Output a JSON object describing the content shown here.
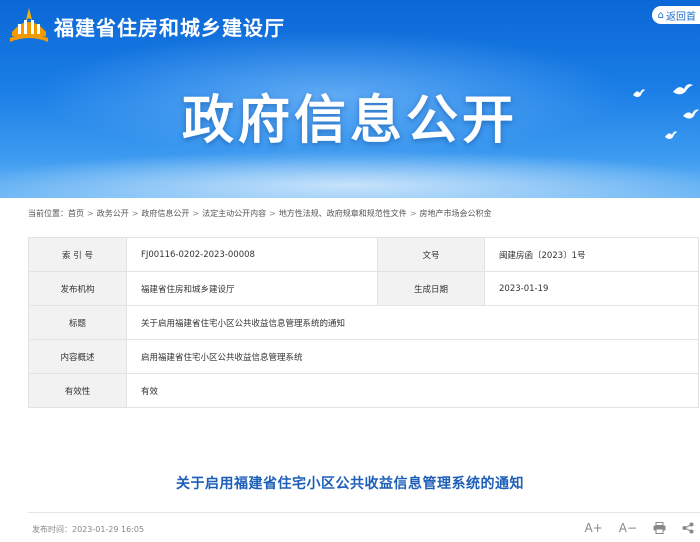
{
  "header": {
    "site_name": "福建省住房和城乡建设厅",
    "back_label": "返回首",
    "big_title": "政府信息公开"
  },
  "breadcrumb": {
    "items": [
      "当前位置：首页",
      "政务公开",
      "政府信息公开",
      "法定主动公开内容",
      "地方性法规、政府规章和规范性文件",
      "房地产市场会公积金"
    ]
  },
  "info": {
    "index_no_label": "索 引 号",
    "index_no_value": "FJ00116-0202-2023-00008",
    "doc_no_label": "文号",
    "doc_no_value": "闽建房函〔2023〕1号",
    "issuer_label": "发布机构",
    "issuer_value": "福建省住房和城乡建设厅",
    "date_label": "生成日期",
    "date_value": "2023-01-19",
    "title_label": "标题",
    "title_value": "关于启用福建省住宅小区公共收益信息管理系统的通知",
    "summary_label": "内容概述",
    "summary_value": "启用福建省住宅小区公共收益信息管理系统",
    "validity_label": "有效性",
    "validity_value": "有效"
  },
  "article": {
    "title": "关于启用福建省住宅小区公共收益信息管理系统的通知",
    "publish_time": "发布时间：2023-01-29 16:05"
  },
  "tools": {
    "font_up": "A+",
    "font_down": "A−",
    "print_icon": "printer-icon",
    "share_icon": "share-icon"
  },
  "colors": {
    "banner_top": "#0b67d6",
    "banner_bottom": "#6fb8f5",
    "title_blue": "#1d5fb8"
  }
}
